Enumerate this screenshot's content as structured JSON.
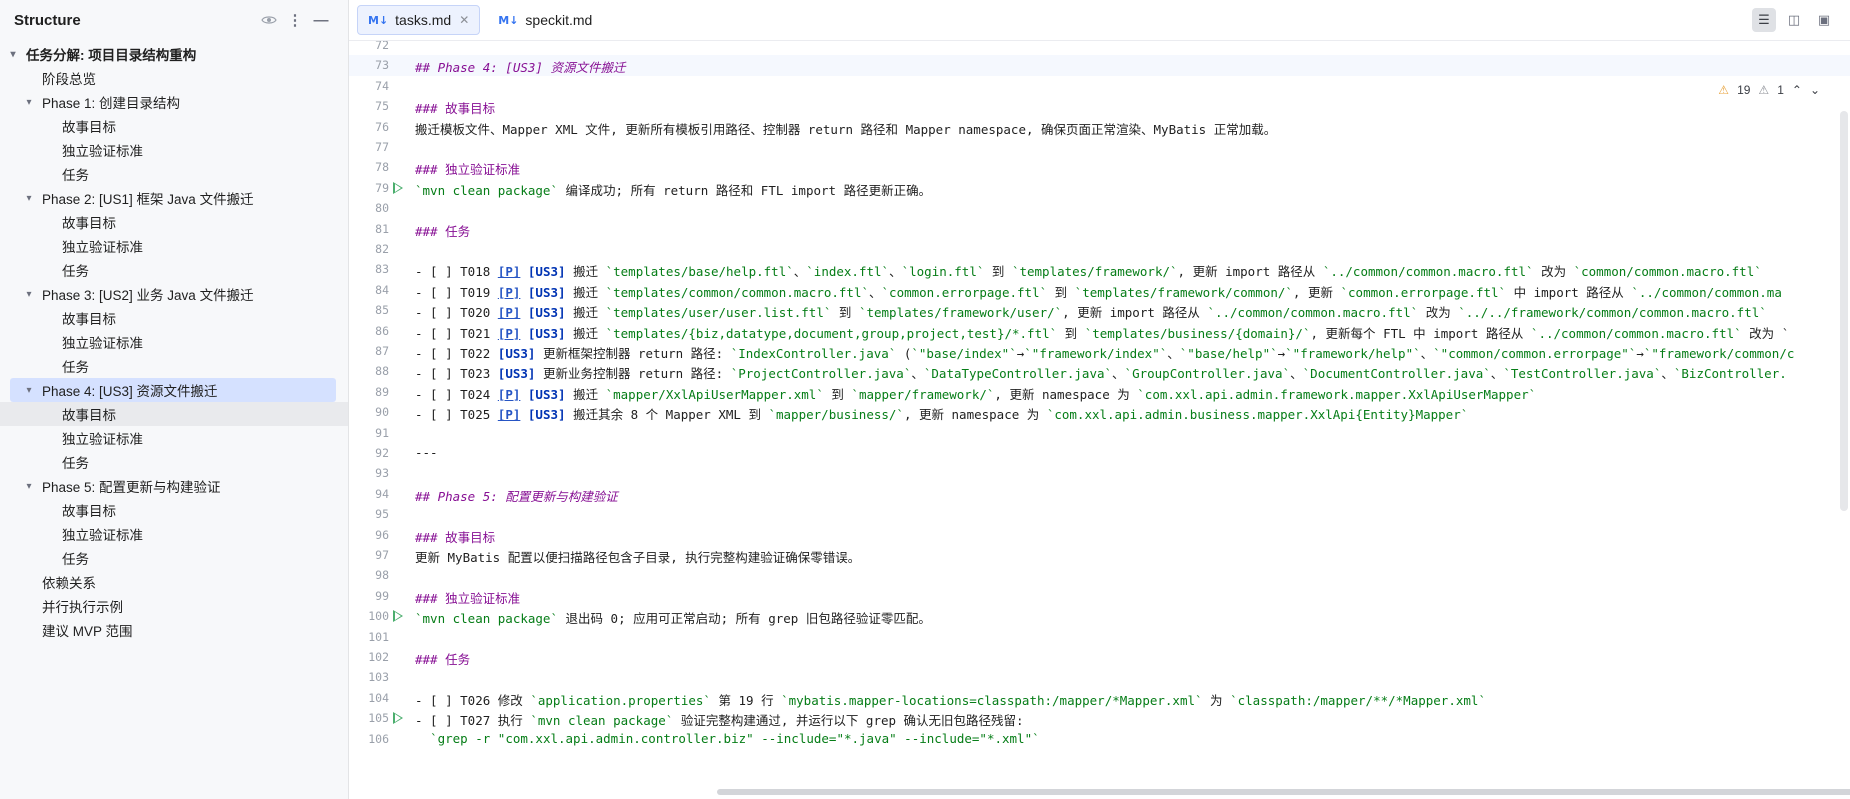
{
  "structure": {
    "title": "Structure",
    "icons": [
      "eye-icon",
      "more-vertical-icon",
      "minimize-icon"
    ],
    "root": "任务分解: 项目目录结构重构",
    "items": [
      {
        "label": "阶段总览",
        "level": 1,
        "leaf": true
      },
      {
        "label": "Phase 1: 创建目录结构",
        "level": 1,
        "leaf": false
      },
      {
        "label": "故事目标",
        "level": 2
      },
      {
        "label": "独立验证标准",
        "level": 2
      },
      {
        "label": "任务",
        "level": 2
      },
      {
        "label": "Phase 2: [US1] 框架 Java 文件搬迁",
        "level": 1,
        "leaf": false
      },
      {
        "label": "故事目标",
        "level": 2
      },
      {
        "label": "独立验证标准",
        "level": 2
      },
      {
        "label": "任务",
        "level": 2
      },
      {
        "label": "Phase 3: [US2] 业务 Java 文件搬迁",
        "level": 1,
        "leaf": false
      },
      {
        "label": "故事目标",
        "level": 2
      },
      {
        "label": "独立验证标准",
        "level": 2
      },
      {
        "label": "任务",
        "level": 2
      },
      {
        "label": "Phase 4: [US3] 资源文件搬迁",
        "level": 1,
        "leaf": false,
        "selected": true
      },
      {
        "label": "故事目标",
        "level": 2,
        "hover": true
      },
      {
        "label": "独立验证标准",
        "level": 2
      },
      {
        "label": "任务",
        "level": 2
      },
      {
        "label": "Phase 5: 配置更新与构建验证",
        "level": 1,
        "leaf": false
      },
      {
        "label": "故事目标",
        "level": 2
      },
      {
        "label": "独立验证标准",
        "level": 2
      },
      {
        "label": "任务",
        "level": 2
      },
      {
        "label": "依赖关系",
        "level": 1,
        "leaf": true
      },
      {
        "label": "并行执行示例",
        "level": 1,
        "leaf": true
      },
      {
        "label": "建议 MVP 范围",
        "level": 1,
        "leaf": true
      }
    ]
  },
  "tabs": [
    {
      "label": "tasks.md",
      "active": true,
      "icon": "M↓"
    },
    {
      "label": "speckit.md",
      "active": false,
      "icon": "M↓"
    }
  ],
  "inspections": {
    "warnings": "19",
    "weak": "1"
  },
  "lines": [
    {
      "n": "72",
      "code": ""
    },
    {
      "n": "73",
      "code": "[[h]]## [[hi]]Phase 4: [US3] 资源文件搬迁[[/]]",
      "cur": true
    },
    {
      "n": "74",
      "code": ""
    },
    {
      "n": "75",
      "code": "[[h]]### 故事目标[[/]]"
    },
    {
      "n": "76",
      "code": "搬迁模板文件、Mapper XML 文件, 更新所有模板引用路径、控制器 return 路径和 Mapper namespace, 确保页面正常渲染、MyBatis 正常加载。"
    },
    {
      "n": "77",
      "code": ""
    },
    {
      "n": "78",
      "code": "[[h]]### 独立验证标准[[/]]"
    },
    {
      "n": "79",
      "code": "[[c]]`mvn clean package`[[/]] 编译成功; 所有 return 路径和 FTL import 路径更新正确。",
      "run": true
    },
    {
      "n": "80",
      "code": ""
    },
    {
      "n": "81",
      "code": "[[h]]### 任务[[/]]"
    },
    {
      "n": "82",
      "code": ""
    },
    {
      "n": "83",
      "code": "- [ ] T018 [[l]][P][[/]] [[k]][US3][[/]] 搬迁 [[c]]`templates/base/help.ftl`[[/]]、[[c]]`index.ftl`[[/]]、[[c]]`login.ftl`[[/]] 到 [[c]]`templates/framework/`[[/]], 更新 import 路径从 [[c]]`../common/common.macro.ftl`[[/]] 改为 [[c]]`common/common.macro.ftl`[[/]]"
    },
    {
      "n": "84",
      "code": "- [ ] T019 [[l]][P][[/]] [[k]][US3][[/]] 搬迁 [[c]]`templates/common/common.macro.ftl`[[/]]、[[c]]`common.errorpage.ftl`[[/]] 到 [[c]]`templates/framework/common/`[[/]], 更新 [[c]]`common.errorpage.ftl`[[/]] 中 import 路径从 [[c]]`../common/common.ma[[/]]"
    },
    {
      "n": "85",
      "code": "- [ ] T020 [[l]][P][[/]] [[k]][US3][[/]] 搬迁 [[c]]`templates/user/user.list.ftl`[[/]] 到 [[c]]`templates/framework/user/`[[/]], 更新 import 路径从 [[c]]`../common/common.macro.ftl`[[/]] 改为 [[c]]`../../framework/common/common.macro.ftl`[[/]]"
    },
    {
      "n": "86",
      "code": "- [ ] T021 [[l]][P][[/]] [[k]][US3][[/]] 搬迁 [[c]]`templates/{biz,datatype,document,group,project,test}/*.ftl`[[/]] 到 [[c]]`templates/business/{domain}/`[[/]], 更新每个 FTL 中 import 路径从 [[c]]`../common/common.macro.ftl`[[/]] 改为 `"
    },
    {
      "n": "87",
      "code": "- [ ] T022 [[k]][US3][[/]] 更新框架控制器 return 路径: [[c]]`IndexController.java`[[/]] ([[c]]`\"base/index\"`[[/]]→[[c]]`\"framework/index\"`[[/]]、[[c]]`\"base/help\"`[[/]]→[[c]]`\"framework/help\"`[[/]]、[[c]]`\"common/common.errorpage\"`[[/]]→[[c]]`\"framework/common/c[[/]]"
    },
    {
      "n": "88",
      "code": "- [ ] T023 [[k]][US3][[/]] 更新业务控制器 return 路径: [[c]]`ProjectController.java`[[/]]、[[c]]`DataTypeController.java`[[/]]、[[c]]`GroupController.java`[[/]]、[[c]]`DocumentController.java`[[/]]、[[c]]`TestController.java`[[/]]、[[c]]`BizController.[[/]]"
    },
    {
      "n": "89",
      "code": "- [ ] T024 [[l]][P][[/]] [[k]][US3][[/]] 搬迁 [[c]]`mapper/XxlApiUserMapper.xml`[[/]] 到 [[c]]`mapper/framework/`[[/]], 更新 namespace 为 [[c]]`com.xxl.api.admin.framework.mapper.XxlApiUserMapper`[[/]]"
    },
    {
      "n": "90",
      "code": "- [ ] T025 [[l]][P][[/]] [[k]][US3][[/]] 搬迁其余 8 个 Mapper XML 到 [[c]]`mapper/business/`[[/]], 更新 namespace 为 [[c]]`com.xxl.api.admin.business.mapper.XxlApi{Entity}Mapper`[[/]]"
    },
    {
      "n": "91",
      "code": ""
    },
    {
      "n": "92",
      "code": "---"
    },
    {
      "n": "93",
      "code": ""
    },
    {
      "n": "94",
      "code": "[[h]]## [[hi]]Phase 5: 配置更新与构建验证[[/]]"
    },
    {
      "n": "95",
      "code": ""
    },
    {
      "n": "96",
      "code": "[[h]]### 故事目标[[/]]"
    },
    {
      "n": "97",
      "code": "更新 MyBatis 配置以便扫描路径包含子目录, 执行完整构建验证确保零错误。"
    },
    {
      "n": "98",
      "code": ""
    },
    {
      "n": "99",
      "code": "[[h]]### 独立验证标准[[/]]"
    },
    {
      "n": "100",
      "code": "[[c]]`mvn clean package`[[/]] 退出码 0; 应用可正常启动; 所有 grep 旧包路径验证零匹配。",
      "run": true
    },
    {
      "n": "101",
      "code": ""
    },
    {
      "n": "102",
      "code": "[[h]]### 任务[[/]]"
    },
    {
      "n": "103",
      "code": ""
    },
    {
      "n": "104",
      "code": "- [ ] T026 修改 [[c]]`application.properties`[[/]] 第 19 行 [[c]]`mybatis.mapper-locations=classpath:/mapper/*Mapper.xml`[[/]] 为 [[c]]`classpath:/mapper/**/*Mapper.xml`[[/]]"
    },
    {
      "n": "105",
      "code": "- [ ] T027 执行 [[c]]`mvn clean package`[[/]] 验证完整构建通过, 并运行以下 grep 确认无旧包路径残留:",
      "run": true
    },
    {
      "n": "106",
      "code": "  [[c]]`grep -r \"com.xxl.api.admin.controller.biz\" --include=\"*.java\" --include=\"*.xml\"`[[/]]"
    }
  ]
}
